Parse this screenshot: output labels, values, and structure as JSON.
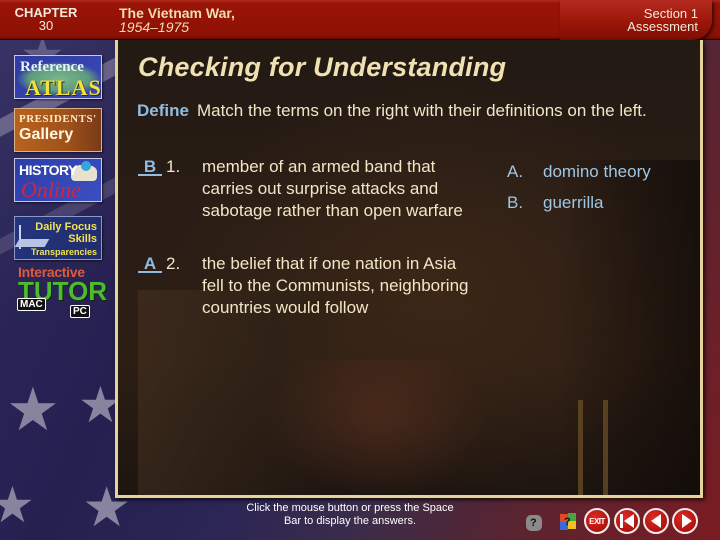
{
  "header": {
    "chapter_label": "CHAPTER",
    "chapter_number": "30",
    "title": "The Vietnam War,",
    "subtitle": "1954–1975",
    "section_line1": "Section 1",
    "section_line2": "Assessment"
  },
  "sidebar": {
    "items": [
      {
        "id": "reference-atlas",
        "line1": "Reference",
        "line2": "ATLAS"
      },
      {
        "id": "presidents-gallery",
        "line1": "PRESIDENTS'",
        "line2": "Gallery"
      },
      {
        "id": "history-online",
        "line1": "HISTORY",
        "line2": "Online"
      },
      {
        "id": "daily-focus",
        "line1": "Daily Focus",
        "line2": "Skills",
        "line3": "Transparencies"
      },
      {
        "id": "interactive-tutor",
        "line1": "Interactive",
        "line2": "TUTOR",
        "mac": "MAC",
        "pc": "PC"
      }
    ]
  },
  "main": {
    "title": "Checking for Understanding",
    "instruction_keyword": "Define",
    "instruction_text": "Match the terms on the right with their definitions on the left.",
    "questions": [
      {
        "answer": "B",
        "number": "1.",
        "definition": "member of an armed band that carries out surprise attacks and sabotage rather than open warfare"
      },
      {
        "answer": "A",
        "number": "2.",
        "definition": "the belief that if one nation in Asia fell to the Communists, neighboring countries would follow"
      }
    ],
    "terms": [
      {
        "letter": "A.",
        "term": "domino theory"
      },
      {
        "letter": "B.",
        "term": "guerrilla"
      }
    ]
  },
  "footer": {
    "hint": "Click the mouse button or press the Space Bar to display the answers.",
    "exit_label": "EXIT",
    "icons": [
      "mac-help-icon",
      "pc-help-icon",
      "exit-icon",
      "first-slide-icon",
      "previous-slide-icon",
      "next-slide-icon"
    ]
  },
  "colors": {
    "header_red": "#8e1004",
    "panel_border": "#e4d49a",
    "title_cream": "#efe1b2",
    "accent_blue": "#8fbce0",
    "nav_red": "#b0120e"
  }
}
